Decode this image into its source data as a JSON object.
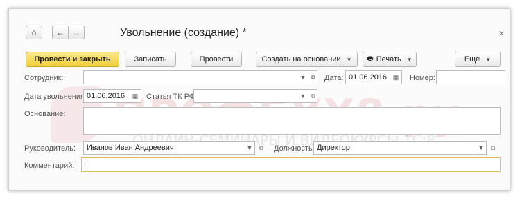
{
  "window": {
    "title": "Увольнение (создание) *",
    "close_icon": "close-icon"
  },
  "nav": {
    "home_icon": "home-icon",
    "back_icon": "arrow-left-icon",
    "forward_icon": "arrow-right-icon"
  },
  "toolbar": {
    "post_close_label": "Провести и закрыть",
    "save_label": "Записать",
    "post_label": "Провести",
    "create_based_label": "Создать на основании",
    "print_label": "Печать",
    "more_label": "Еще"
  },
  "form": {
    "employee_label": "Сотрудник:",
    "employee_value": "",
    "date_label": "Дата:",
    "date_value": "01.06.2016",
    "number_label": "Номер:",
    "number_value": "",
    "dismissal_date_label": "Дата увольнения:",
    "dismissal_date_value": "01.06.2016",
    "article_label": "Статья ТК РФ:",
    "article_value": "",
    "basis_label": "Основание:",
    "basis_value": "",
    "manager_label": "Руководитель:",
    "manager_value": "Иванов Иван Андреевич",
    "position_label": "Должность:",
    "position_value": "Директор",
    "comment_label": "Комментарий:",
    "comment_value": ""
  },
  "watermark": {
    "brand": "ПРОФБУХ8.ру",
    "tagline": "ОНЛАЙН-СЕМИНАРЫ И ВИДЕОКУРСЫ 1С:8"
  },
  "colors": {
    "primary_button": "#f1cf38",
    "comment_border": "#e2c24a",
    "watermark_red": "#d66266"
  }
}
